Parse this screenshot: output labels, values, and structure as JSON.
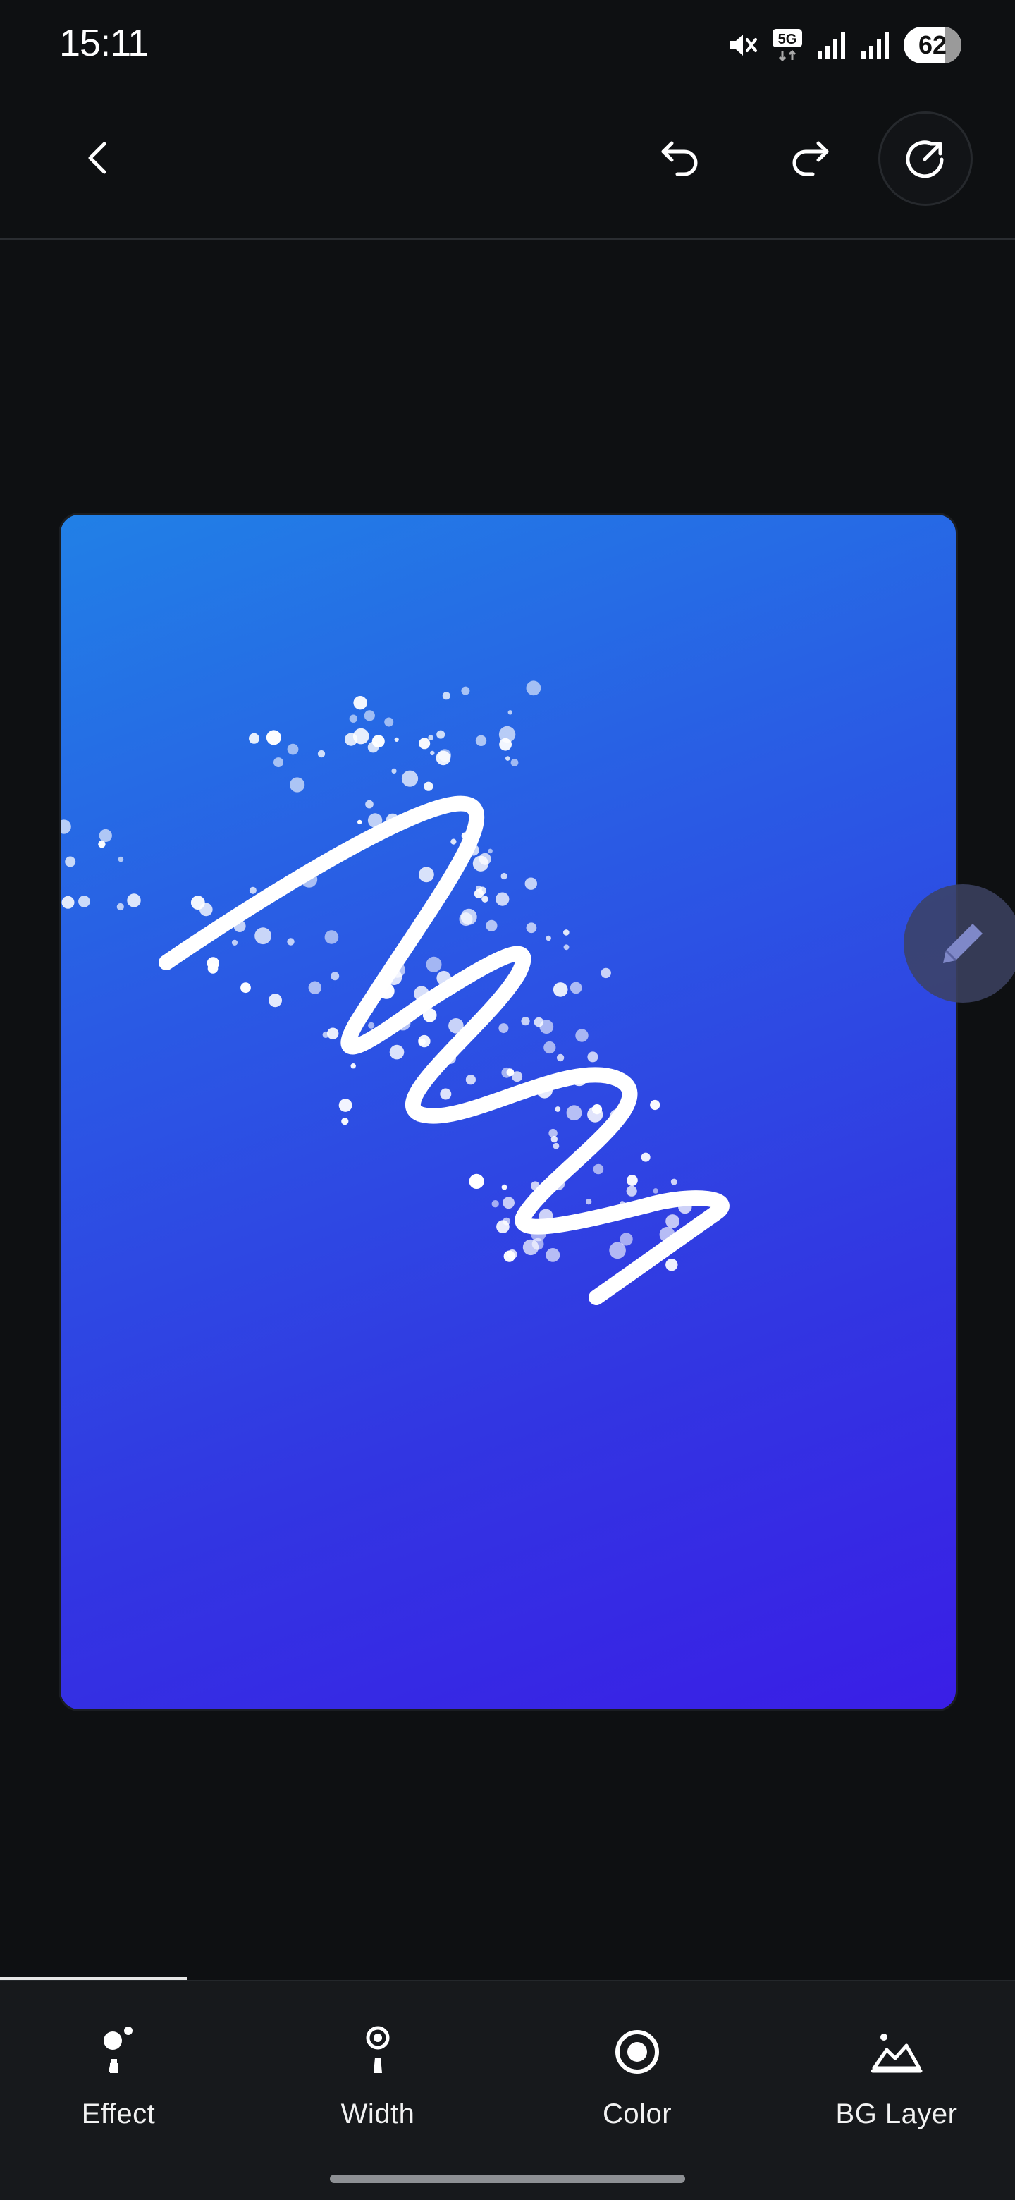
{
  "status_bar": {
    "time": "15:11",
    "network_label": "5G",
    "battery": "62",
    "icons": [
      "mute-icon",
      "5g-icon",
      "signal-icon",
      "signal-icon",
      "battery-icon"
    ]
  },
  "toolbar": {
    "icons": [
      "back-icon",
      "undo-icon",
      "redo-icon",
      "export-icon"
    ]
  },
  "canvas": {
    "gradient_colors": [
      "#2180e6",
      "#3a1ee6"
    ],
    "stroke_color": "#ffffff",
    "effect": "sparkle particles"
  },
  "floating_tool": {
    "icon": "pencil-icon"
  },
  "bottom_tabs": [
    {
      "label": "Effect",
      "icon": "effect-icon",
      "active": true
    },
    {
      "label": "Width",
      "icon": "width-icon",
      "active": false
    },
    {
      "label": "Color",
      "icon": "color-icon",
      "active": false
    },
    {
      "label": "BG Layer",
      "icon": "bg-layer-icon",
      "active": false
    }
  ]
}
